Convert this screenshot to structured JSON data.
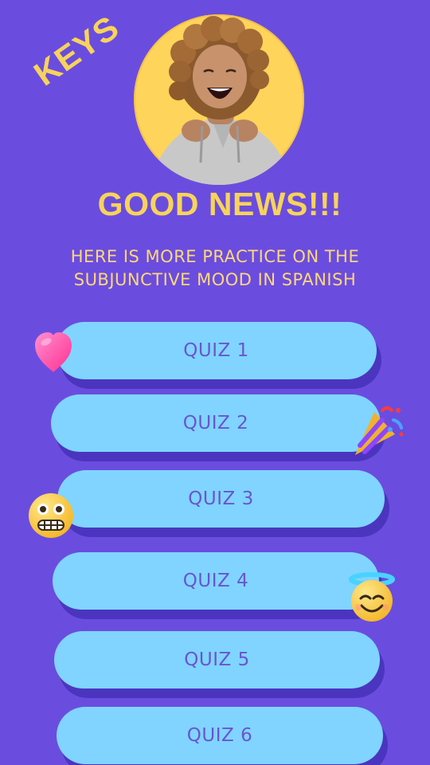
{
  "keys_label": "KEYS",
  "headline": "GOOD NEWS!!!",
  "subtitle": "HERE IS MORE PRACTICE ON THE\nSUBJUNCTIVE MOOD IN SPANISH",
  "quizzes": [
    {
      "label": "QUIZ 1"
    },
    {
      "label": "QUIZ 2"
    },
    {
      "label": "QUIZ 3"
    },
    {
      "label": "QUIZ 4"
    },
    {
      "label": "QUIZ 5"
    },
    {
      "label": "QUIZ 6"
    }
  ],
  "colors": {
    "background": "#6a4ddf",
    "accent_yellow": "#f8d35a",
    "button_blue": "#7fd5ff",
    "button_shadow": "#4b35bf",
    "button_text": "#6b54cf"
  },
  "icons": {
    "decor_1": "heart-emoji",
    "decor_2": "party-popper-emoji",
    "decor_3": "grimacing-face-emoji",
    "decor_4": "smiling-face-with-halo-emoji"
  }
}
